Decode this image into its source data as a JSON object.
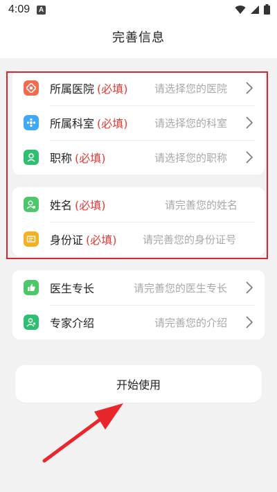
{
  "status_bar": {
    "time": "4:09",
    "notification_glyph": "A",
    "icons": [
      "wifi-icon",
      "signal-icon",
      "battery-icon"
    ]
  },
  "header": {
    "title": "完善信息"
  },
  "form": {
    "required_tag": "(必填)",
    "group1": [
      {
        "label": "所属医院",
        "hint": "请选择您的医院",
        "icon": "hospital-icon",
        "color": "#f26b4f"
      },
      {
        "label": "所属科室",
        "hint": "请选择您的科室",
        "icon": "department-icon",
        "color": "#3fa9f5"
      },
      {
        "label": "职称",
        "hint": "请选择您的职称",
        "icon": "title-icon",
        "color": "#2fbf71"
      }
    ],
    "group2": [
      {
        "label": "姓名",
        "hint": "请完善您的姓名",
        "icon": "name-icon",
        "color": "#4cc76a"
      },
      {
        "label": "身份证",
        "hint": "请完善您的身份证号",
        "icon": "id-card-icon",
        "color": "#f6b021"
      }
    ],
    "group3": [
      {
        "label": "医生专长",
        "hint": "请完善您的医生专长",
        "icon": "thumbs-up-icon",
        "color": "#4cc76a"
      },
      {
        "label": "专家介绍",
        "hint": "请完善您的介绍",
        "icon": "expert-icon",
        "color": "#2fbf71"
      }
    ]
  },
  "actions": {
    "start_label": "开始使用"
  },
  "colors": {
    "highlight": "#d9252b",
    "required": "#e53935",
    "hint": "#a8a8a8",
    "background": "#f2f2f2"
  }
}
